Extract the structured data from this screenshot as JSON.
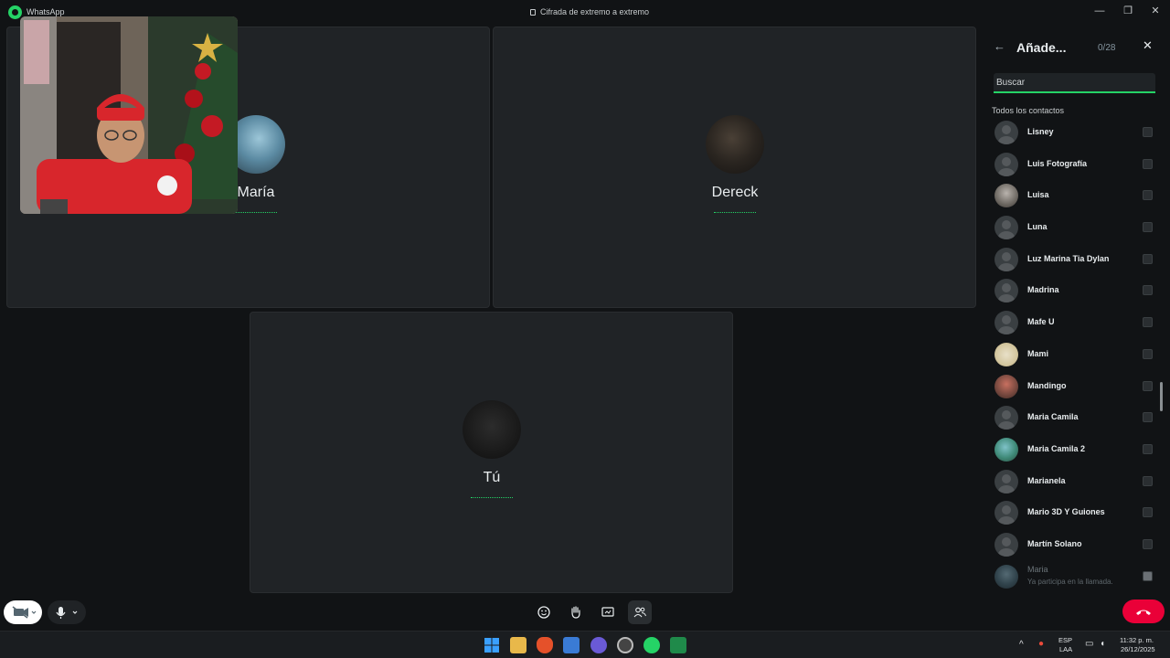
{
  "titlebar": {
    "app_name": "WhatsApp",
    "encryption": "Cifrada de extremo a extremo",
    "minimize": "—",
    "restore": "❐",
    "close": "✕"
  },
  "call": {
    "participants": [
      {
        "name": "María"
      },
      {
        "name": "Dereck"
      },
      {
        "name": "Tú"
      }
    ],
    "end_call_icon": "phone-hangup-icon"
  },
  "panel": {
    "title": "Añade...",
    "count": "0/28",
    "back_glyph": "←",
    "close_glyph": "✕",
    "search_placeholder": "Buscar",
    "section_label": "Todos los contactos",
    "contacts": [
      {
        "name": "Lisney"
      },
      {
        "name": "Luis Fotografía"
      },
      {
        "name": "Luisa"
      },
      {
        "name": "Luna"
      },
      {
        "name": "Luz Marina Tia Dylan"
      },
      {
        "name": "Madrina"
      },
      {
        "name": "Mafe U"
      },
      {
        "name": "Mami"
      },
      {
        "name": "Mandingo"
      },
      {
        "name": "Maria Camila"
      },
      {
        "name": "Maria Camila 2"
      },
      {
        "name": "Marianela"
      },
      {
        "name": "Mario 3D Y Guiones"
      },
      {
        "name": "Martín Solano"
      }
    ],
    "disabled_contact": {
      "name": "Maria",
      "status": "Ya participa en la llamada."
    }
  },
  "taskbar": {
    "lang_top": "ESP",
    "lang_bottom": "LAA",
    "time": "11:32 p. m.",
    "date": "26/12/2025"
  },
  "colors": {
    "accent": "#25d366",
    "end_call": "#ea0038",
    "tile_bg": "#202326"
  }
}
